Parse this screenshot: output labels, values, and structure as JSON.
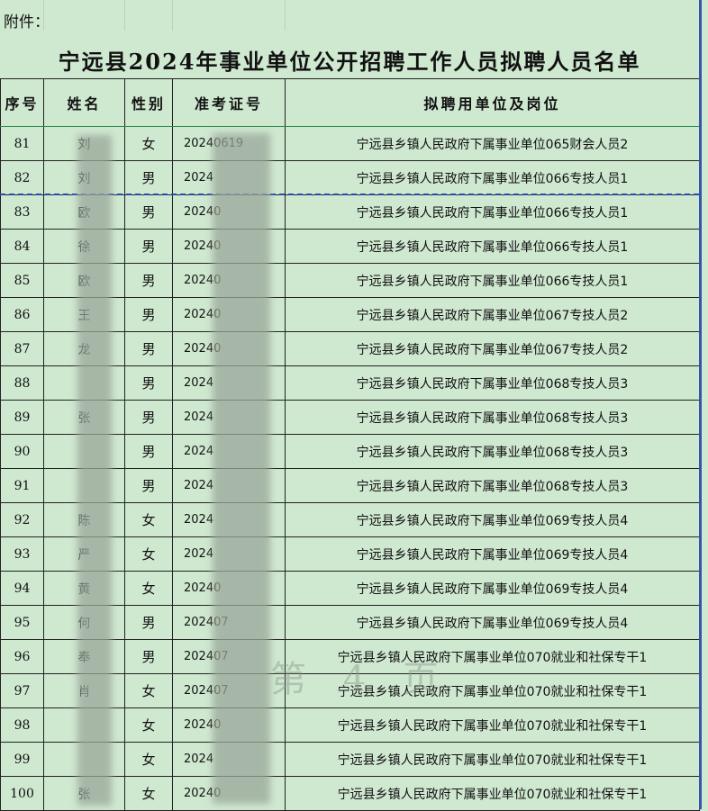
{
  "attachment_label": "附件：",
  "title": "宁远县2024年事业单位公开招聘工作人员拟聘人员名单",
  "headers": [
    "序号",
    "姓名",
    "性别",
    "准考证号",
    "拟聘用单位及岗位"
  ],
  "rows": [
    {
      "no": "81",
      "name": "刘",
      "sex": "女",
      "exam": "20240619",
      "unit": "宁远县乡镇人民政府下属事业单位065财会人员2"
    },
    {
      "no": "82",
      "name": "刘",
      "sex": "男",
      "exam": "2024",
      "unit": "宁远县乡镇人民政府下属事业单位066专技人员1"
    },
    {
      "no": "83",
      "name": "欧",
      "sex": "男",
      "exam": "20240",
      "unit": "宁远县乡镇人民政府下属事业单位066专技人员1"
    },
    {
      "no": "84",
      "name": "徐",
      "sex": "男",
      "exam": "20240",
      "unit": "宁远县乡镇人民政府下属事业单位066专技人员1"
    },
    {
      "no": "85",
      "name": "欧",
      "sex": "男",
      "exam": "20240",
      "unit": "宁远县乡镇人民政府下属事业单位066专技人员1"
    },
    {
      "no": "86",
      "name": "王",
      "sex": "男",
      "exam": "20240",
      "unit": "宁远县乡镇人民政府下属事业单位067专技人员2"
    },
    {
      "no": "87",
      "name": "龙",
      "sex": "男",
      "exam": "20240",
      "unit": "宁远县乡镇人民政府下属事业单位067专技人员2"
    },
    {
      "no": "88",
      "name": "",
      "sex": "男",
      "exam": "2024",
      "unit": "宁远县乡镇人民政府下属事业单位068专技人员3"
    },
    {
      "no": "89",
      "name": "张",
      "sex": "男",
      "exam": "2024",
      "unit": "宁远县乡镇人民政府下属事业单位068专技人员3"
    },
    {
      "no": "90",
      "name": "",
      "sex": "男",
      "exam": "2024",
      "unit": "宁远县乡镇人民政府下属事业单位068专技人员3"
    },
    {
      "no": "91",
      "name": "",
      "sex": "男",
      "exam": "2024",
      "unit": "宁远县乡镇人民政府下属事业单位068专技人员3"
    },
    {
      "no": "92",
      "name": "陈",
      "sex": "女",
      "exam": "2024",
      "unit": "宁远县乡镇人民政府下属事业单位069专技人员4"
    },
    {
      "no": "93",
      "name": "严",
      "sex": "女",
      "exam": "2024",
      "unit": "宁远县乡镇人民政府下属事业单位069专技人员4"
    },
    {
      "no": "94",
      "name": "黄",
      "sex": "女",
      "exam": "20240",
      "unit": "宁远县乡镇人民政府下属事业单位069专技人员4"
    },
    {
      "no": "95",
      "name": "何",
      "sex": "男",
      "exam": "202407",
      "unit": "宁远县乡镇人民政府下属事业单位069专技人员4"
    },
    {
      "no": "96",
      "name": "奉",
      "sex": "男",
      "exam": "202407",
      "unit": "宁远县乡镇人民政府下属事业单位070就业和社保专干1"
    },
    {
      "no": "97",
      "name": "肖",
      "sex": "女",
      "exam": "202407",
      "unit": "宁远县乡镇人民政府下属事业单位070就业和社保专干1"
    },
    {
      "no": "98",
      "name": "",
      "sex": "女",
      "exam": "20240",
      "unit": "宁远县乡镇人民政府下属事业单位070就业和社保专干1"
    },
    {
      "no": "99",
      "name": "",
      "sex": "女",
      "exam": "2024",
      "unit": "宁远县乡镇人民政府下属事业单位070就业和社保专干1"
    },
    {
      "no": "100",
      "name": "张",
      "sex": "女",
      "exam": "20240",
      "unit": "宁远县乡镇人民政府下属事业单位070就业和社保专干1"
    }
  ],
  "watermark": "第 4 页",
  "colors": {
    "background": "#cfe8d0",
    "border": "#222222",
    "page_break": "#2b4ab0"
  }
}
